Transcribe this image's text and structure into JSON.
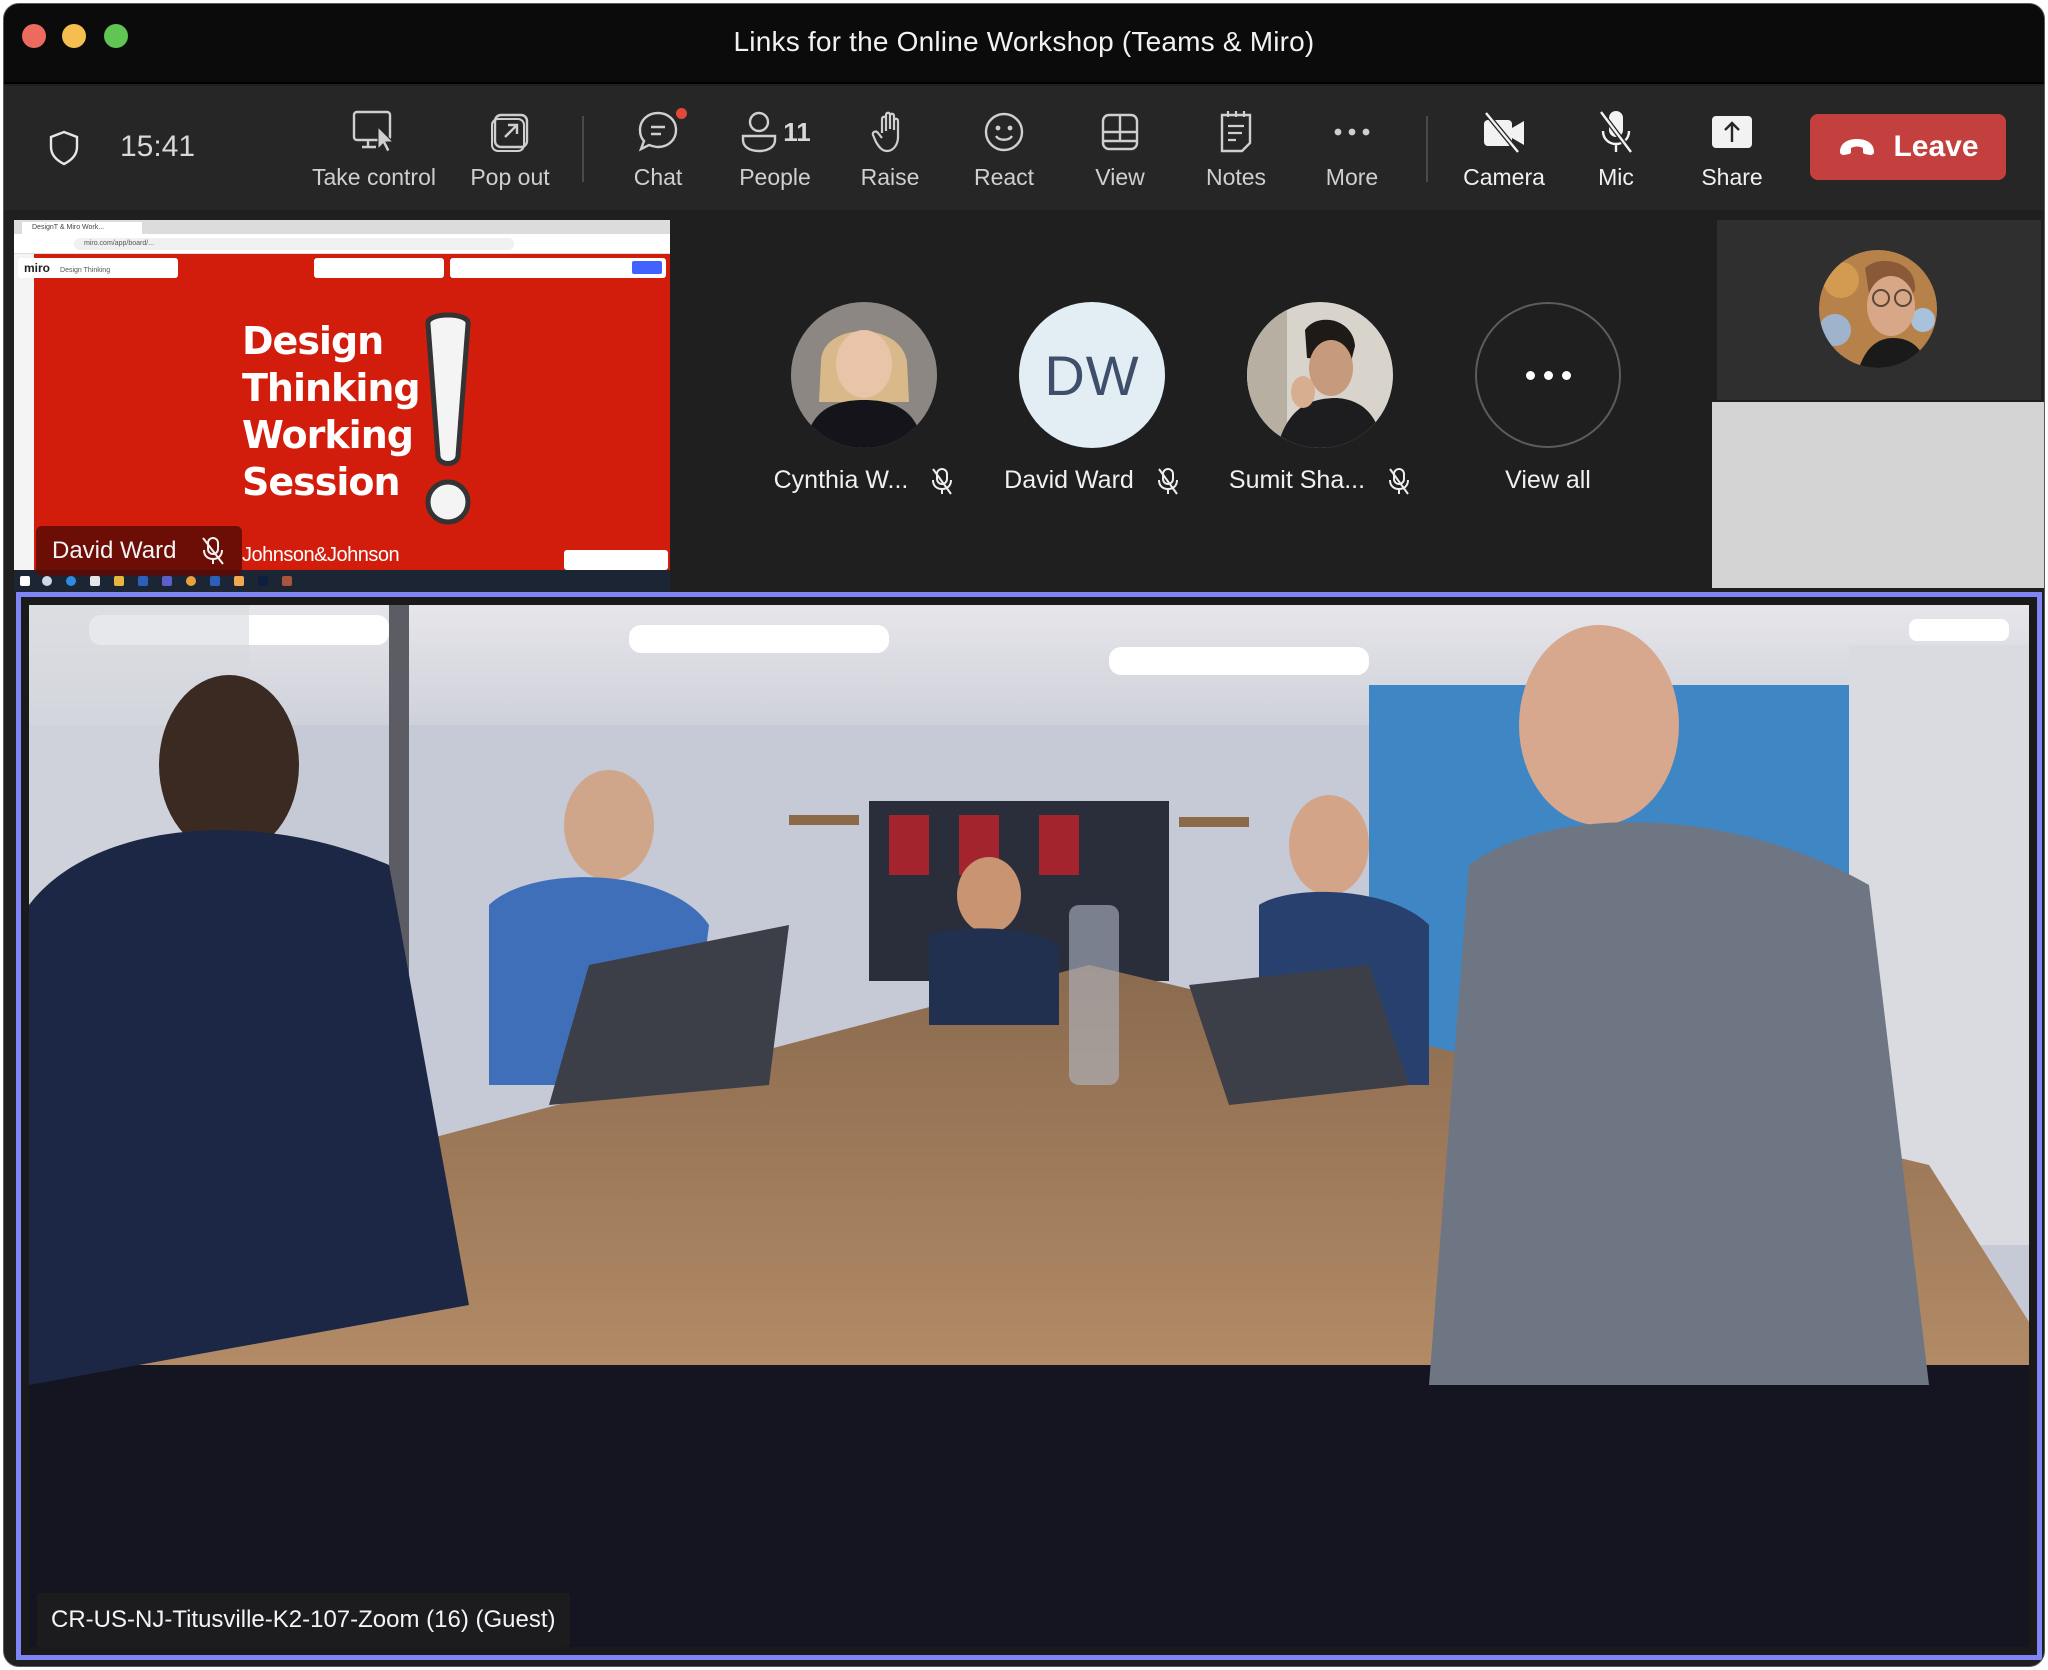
{
  "window": {
    "title": "Links for the Online Workshop (Teams & Miro)"
  },
  "toolbar": {
    "shield_icon": "shield-icon",
    "time": "15:41",
    "buttons": {
      "take_control": "Take control",
      "pop_out": "Pop out",
      "chat": "Chat",
      "people": "People",
      "people_count": "11",
      "raise": "Raise",
      "react": "React",
      "view": "View",
      "notes": "Notes",
      "more": "More",
      "camera": "Camera",
      "mic": "Mic",
      "share": "Share",
      "leave": "Leave"
    },
    "colors": {
      "leave": "#c4403e",
      "chat_badge": "#e0493a"
    }
  },
  "shared_screen": {
    "presenter_name": "David Ward",
    "presenter_muted": true,
    "browser_tab": "DesignT & Miro Work...",
    "browser_url": "miro.com/app/board/...",
    "miro_logo": "miro",
    "miro_board_name": "Design Thinking",
    "slide_title_lines": [
      "Design",
      "Thinking",
      "Working",
      "Session"
    ],
    "slide_brand": "Johnson&Johnson",
    "slide_bg": "#d21c0c"
  },
  "participants": [
    {
      "name": "Cynthia W...",
      "muted": true,
      "avatar": "photo"
    },
    {
      "name": "David Ward",
      "initials": "DW",
      "muted": true,
      "avatar": "initials"
    },
    {
      "name": "Sumit Sha...",
      "muted": true,
      "avatar": "photo"
    }
  ],
  "view_all": {
    "label": "View all"
  },
  "main_stage": {
    "participant_label": "CR-US-NJ-Titusville-K2-107-Zoom (16) (Guest)",
    "active_speaker_border": "#7f85f5"
  }
}
